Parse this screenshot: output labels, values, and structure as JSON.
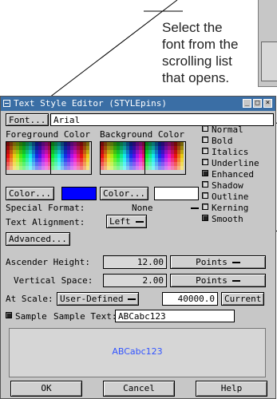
{
  "callout": {
    "lines": [
      "Select the",
      "font from the",
      "scrolling list",
      "that opens."
    ]
  },
  "window": {
    "title": "Text Style Editor (STYLEpins)",
    "title_buttons": [
      "_",
      "□",
      "×"
    ]
  },
  "font": {
    "button_label": "Font...",
    "value": "Arial"
  },
  "colors": {
    "foreground_label": "Foreground Color",
    "background_label": "Background Color",
    "foreground_button": "Color...",
    "background_button": "Color...",
    "foreground_value": "#0000ff",
    "background_value": "#ffffff"
  },
  "styles": [
    {
      "label": "Normal",
      "checked": false
    },
    {
      "label": "Bold",
      "checked": false
    },
    {
      "label": "Italics",
      "checked": false
    },
    {
      "label": "Underline",
      "checked": false
    },
    {
      "label": "Enhanced",
      "checked": true
    },
    {
      "label": "Shadow",
      "checked": false
    },
    {
      "label": "Outline",
      "checked": false
    },
    {
      "label": "Kerning",
      "checked": false
    },
    {
      "label": "Smooth",
      "checked": true
    }
  ],
  "special_format": {
    "label": "Special Format:",
    "value": "None"
  },
  "text_alignment": {
    "label": "Text Alignment:",
    "value": "Left"
  },
  "advanced_label": "Advanced...",
  "ascender": {
    "label": "Ascender Height:",
    "value": "12.00",
    "units": "Points"
  },
  "vertical_space": {
    "label": "Vertical Space:",
    "value": "2.00",
    "units": "Points"
  },
  "scale": {
    "label": "At Scale:",
    "mode": "User-Defined",
    "value": "40000.0",
    "current_label": "Current"
  },
  "sample": {
    "checkbox_label": "Sample",
    "text_label": "Sample Text:",
    "text_value": "ABCabc123",
    "preview": "ABCabc123"
  },
  "buttons": {
    "ok": "OK",
    "cancel": "Cancel",
    "help": "Help"
  }
}
